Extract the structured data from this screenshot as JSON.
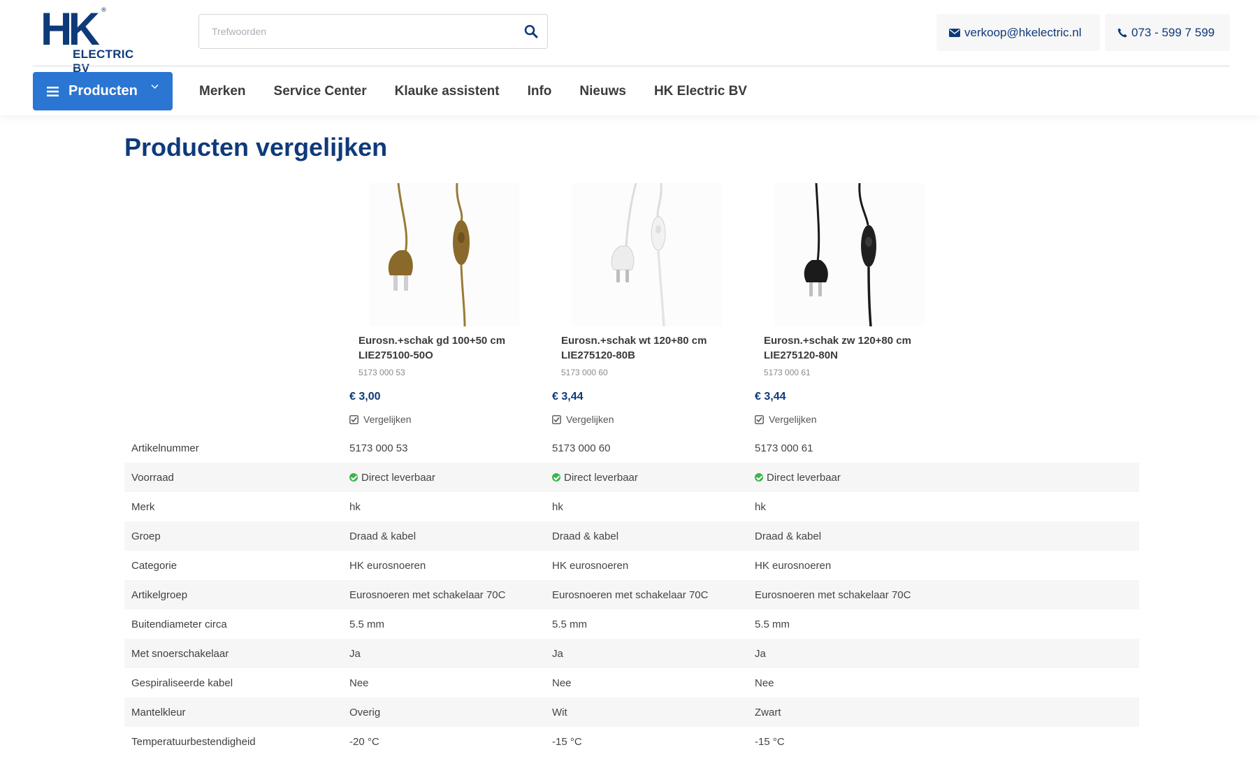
{
  "header": {
    "logo_text": "HK",
    "logo_sub": "ELECTRIC BV",
    "logo_reg": "®",
    "search_placeholder": "Trefwoorden",
    "email": "verkoop@hkelectric.nl",
    "phone": "073 - 599 7 599"
  },
  "nav": {
    "products_label": "Producten",
    "items": [
      "Merken",
      "Service Center",
      "Klauke assistent",
      "Info",
      "Nieuws",
      "HK Electric BV"
    ]
  },
  "page_title": "Producten vergelijken",
  "products": [
    {
      "name": "Eurosn.+schak gd 100+50 cm",
      "code": "LIE275100-50O",
      "number": "5173 000 53",
      "price": "€ 3,00",
      "compare_label": "Vergelijken",
      "image": "gold-cord-icon",
      "cord_color": "#9a7a38"
    },
    {
      "name": "Eurosn.+schak wt 120+80 cm",
      "code": "LIE275120-80B",
      "number": "5173 000 60",
      "price": "€ 3,44",
      "compare_label": "Vergelijken",
      "image": "white-cord-icon",
      "cord_color": "#e9e9e9"
    },
    {
      "name": "Eurosn.+schak zw 120+80 cm",
      "code": "LIE275120-80N",
      "number": "5173 000 61",
      "price": "€ 3,44",
      "compare_label": "Vergelijken",
      "image": "black-cord-icon",
      "cord_color": "#1b1b1b"
    }
  ],
  "specs": [
    {
      "label": "Artikelnummer",
      "values": [
        "5173 000 53",
        "5173 000 60",
        "5173 000 61"
      ]
    },
    {
      "label": "Voorraad",
      "values": [
        "Direct leverbaar",
        "Direct leverbaar",
        "Direct leverbaar"
      ],
      "status": true
    },
    {
      "label": "Merk",
      "values": [
        "hk",
        "hk",
        "hk"
      ]
    },
    {
      "label": "Groep",
      "values": [
        "Draad & kabel",
        "Draad & kabel",
        "Draad & kabel"
      ]
    },
    {
      "label": "Categorie",
      "values": [
        "HK eurosnoeren",
        "HK eurosnoeren",
        "HK eurosnoeren"
      ]
    },
    {
      "label": "Artikelgroep",
      "values": [
        "Eurosnoeren met schakelaar 70C",
        "Eurosnoeren met schakelaar 70C",
        "Eurosnoeren met schakelaar 70C"
      ]
    },
    {
      "label": "Buitendiameter circa",
      "values": [
        "5.5 mm",
        "5.5 mm",
        "5.5 mm"
      ]
    },
    {
      "label": "Met snoerschakelaar",
      "values": [
        "Ja",
        "Ja",
        "Ja"
      ]
    },
    {
      "label": "Gespiraliseerde kabel",
      "values": [
        "Nee",
        "Nee",
        "Nee"
      ]
    },
    {
      "label": "Mantelkleur",
      "values": [
        "Overig",
        "Wit",
        "Zwart"
      ]
    },
    {
      "label": "Temperatuurbestendigheid",
      "values": [
        "-20 °C",
        "-15 °C",
        "-15 °C"
      ]
    }
  ],
  "colors": {
    "brand": "#0e3a7a",
    "accent": "#2a76d2",
    "ok": "#3bb54a"
  }
}
